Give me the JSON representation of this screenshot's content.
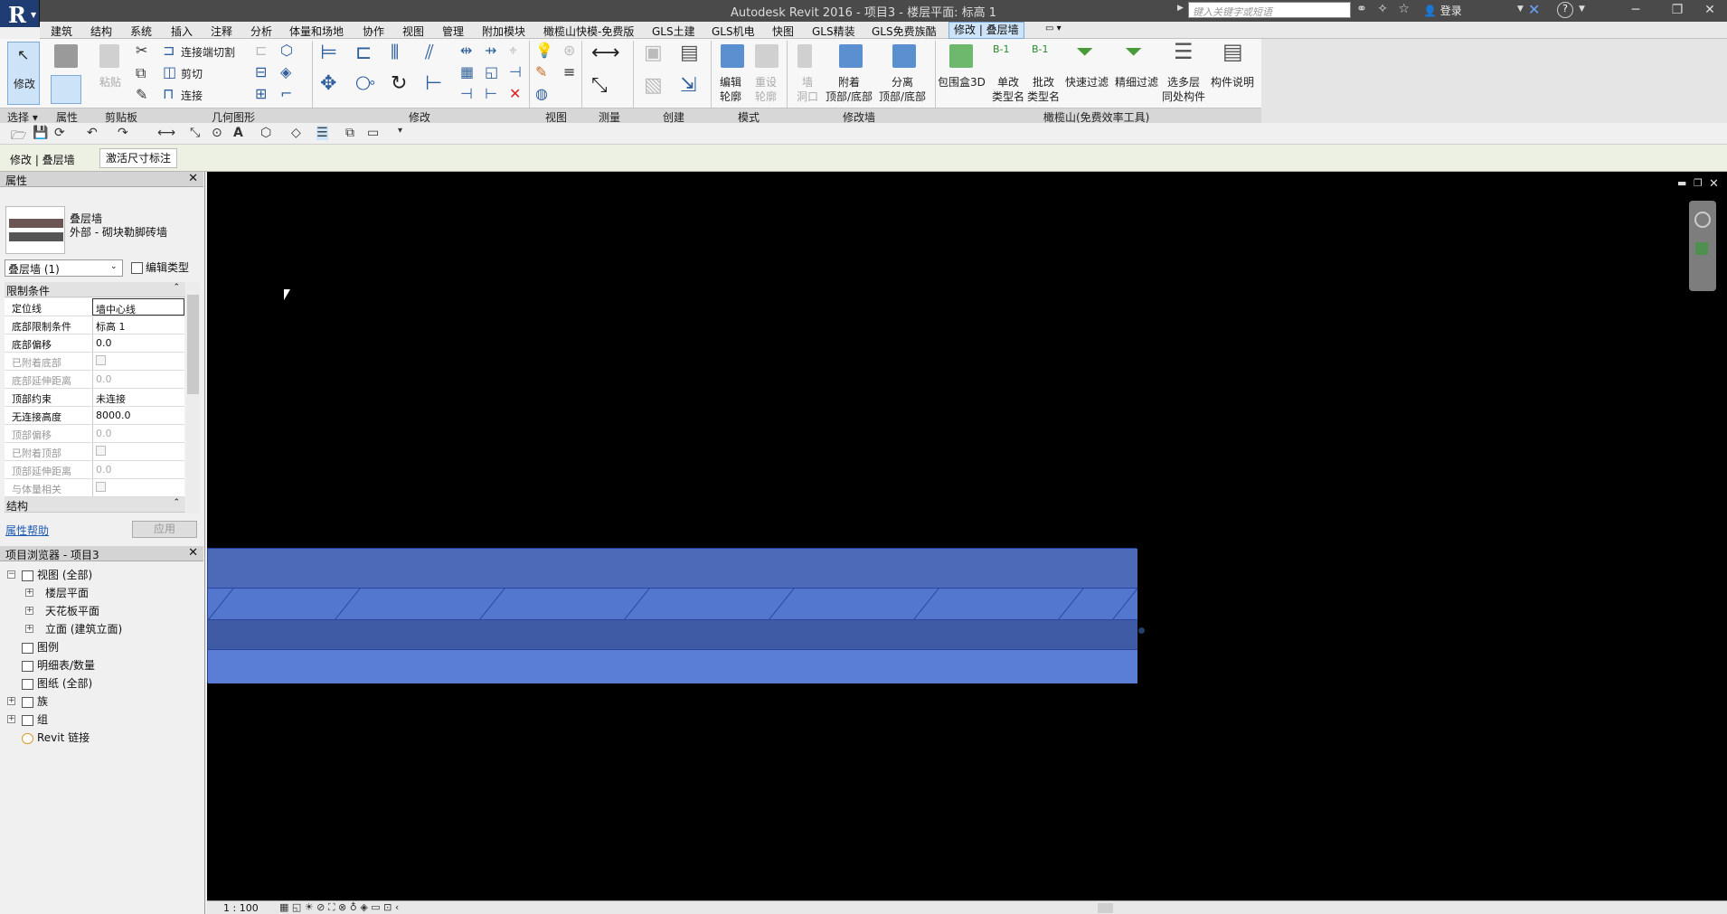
{
  "titlebar": {
    "title": "Autodesk Revit 2016 -     项目3 - 楼层平面: 标高 1",
    "search_placeholder": "键入关键字或短语",
    "login": "登录"
  },
  "ribbon_tabs": [
    "建筑",
    "结构",
    "系统",
    "插入",
    "注释",
    "分析",
    "体量和场地",
    "协作",
    "视图",
    "管理",
    "附加模块",
    "橄榄山快模-免费版",
    "GLS土建",
    "GLS机电",
    "快图",
    "GLS精装",
    "GLS免费族酷",
    "修改 | 叠层墙"
  ],
  "ribbon": {
    "modify_label": "修改",
    "paste_label": "粘贴",
    "cut_join_label": "连接端切割",
    "cut_label": "剪切",
    "join_label": "连接",
    "edit_profile_label": "编辑\n轮廓",
    "reset_profile_label": "重设\n轮廓",
    "wall_opening_label": "墙\n洞口",
    "attach_label": "附着\n顶部/底部",
    "detach_label": "分离\n顶部/底部",
    "box3d_label": "包围盒3D",
    "single_rename_label": "单改\n类型名",
    "batch_rename_label": "批改\n类型名",
    "quick_filter_label": "快速过滤",
    "fine_filter_label": "精细过滤",
    "multi_level_label": "选多层\n同处构件",
    "component_desc_label": "构件说明",
    "panels": {
      "select": "选择 ▾",
      "properties": "属性",
      "clipboard": "剪贴板",
      "geometry": "几何图形",
      "modify": "修改",
      "view": "视图",
      "measure": "测量",
      "create": "创建",
      "mode": "模式",
      "modify_wall": "修改墙",
      "olive": "橄榄山(免费效率工具)"
    }
  },
  "optionbar": {
    "context": "修改 | 叠层墙",
    "activate_dims": "激活尺寸标注"
  },
  "properties": {
    "title": "属性",
    "type_name": "叠层墙",
    "type_sub": "外部 - 砌块勒脚砖墙",
    "instance": "叠层墙 (1)",
    "edit_type": "编辑类型",
    "group_constraints": "限制条件",
    "group_structure": "结构",
    "rows": [
      {
        "name": "定位线",
        "value": "墙中心线",
        "dim": false,
        "check": false
      },
      {
        "name": "底部限制条件",
        "value": "标高 1",
        "dim": false,
        "check": false
      },
      {
        "name": "底部偏移",
        "value": "0.0",
        "dim": false,
        "check": false
      },
      {
        "name": "已附着底部",
        "value": "",
        "dim": true,
        "check": true
      },
      {
        "name": "底部延伸距离",
        "value": "0.0",
        "dim": true,
        "check": false
      },
      {
        "name": "顶部约束",
        "value": "未连接",
        "dim": false,
        "check": false
      },
      {
        "name": "无连接高度",
        "value": "8000.0",
        "dim": false,
        "check": false
      },
      {
        "name": "顶部偏移",
        "value": "0.0",
        "dim": true,
        "check": false
      },
      {
        "name": "已附着顶部",
        "value": "",
        "dim": true,
        "check": true
      },
      {
        "name": "顶部延伸距离",
        "value": "0.0",
        "dim": true,
        "check": false
      },
      {
        "name": "与体量相关",
        "value": "",
        "dim": true,
        "check": true
      }
    ],
    "help_link": "属性帮助",
    "apply": "应用"
  },
  "browser": {
    "title": "项目浏览器 - 项目3",
    "items": [
      "视图 (全部)",
      "楼层平面",
      "天花板平面",
      "立面 (建筑立面)",
      "图例",
      "明细表/数量",
      "图纸 (全部)",
      "族",
      "组",
      "Revit 链接"
    ]
  },
  "status": {
    "scale": "1 : 100"
  }
}
